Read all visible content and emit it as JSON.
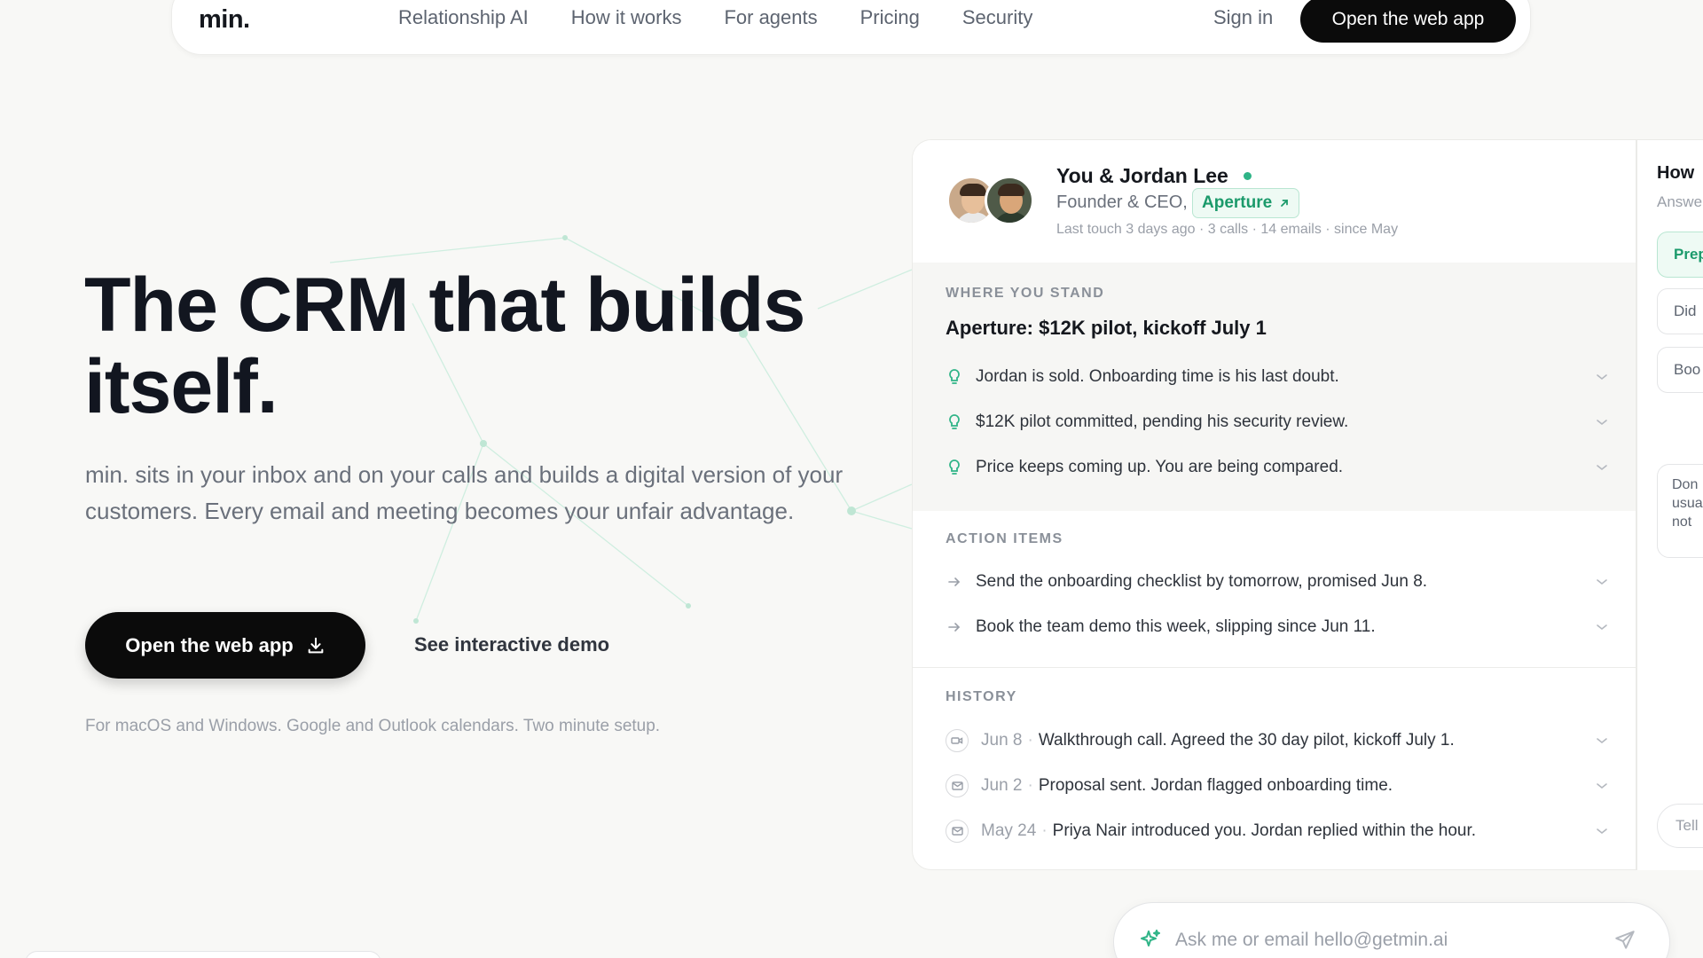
{
  "nav": {
    "logo": "min.",
    "links": [
      "Relationship AI",
      "How it works",
      "For agents",
      "Pricing",
      "Security"
    ],
    "signin": "Sign in",
    "cta": "Open the web app"
  },
  "hero": {
    "title": "The CRM that builds itself.",
    "subtitle": "min. sits in your inbox and on your calls and builds a digital version of your customers. Every email and meeting becomes your unfair advantage.",
    "cta": "Open the web app",
    "demo": "See interactive demo",
    "footnote": "For macOS and Windows. Google and Outlook calendars. Two minute setup."
  },
  "card": {
    "name": "You & Jordan Lee",
    "role": "Founder & CEO,",
    "company": "Aperture",
    "meta": "Last touch 3 days ago · 3 calls · 14 emails · since May",
    "stand": {
      "label": "WHERE YOU STAND",
      "title": "Aperture: $12K pilot, kickoff July 1",
      "items": [
        "Jordan is sold. Onboarding time is his last doubt.",
        "$12K pilot committed, pending his security review.",
        "Price keeps coming up. You are being compared."
      ]
    },
    "actions": {
      "label": "ACTION ITEMS",
      "items": [
        "Send the onboarding checklist by tomorrow, promised Jun 8.",
        "Book the team demo this week, slipping since Jun 11."
      ]
    },
    "history": {
      "label": "HISTORY",
      "items": [
        {
          "icon": "video-icon",
          "date": "Jun 8",
          "text": "Walkthrough call. Agreed the 30 day pilot, kickoff July 1."
        },
        {
          "icon": "mail-icon",
          "date": "Jun 2",
          "text": "Proposal sent. Jordan flagged onboarding time."
        },
        {
          "icon": "mail-icon",
          "date": "May 24",
          "text": "Priya Nair introduced you. Jordan replied within the hour."
        }
      ]
    }
  },
  "side_panel": {
    "title": "How",
    "subtitle": "Answe",
    "buttons": [
      "Prep",
      "Did",
      "Boo"
    ],
    "note_lines": [
      "Don",
      "usua",
      "not"
    ],
    "input_placeholder": "Tell"
  },
  "ask": {
    "placeholder": "Ask me or email hello@getmin.ai"
  },
  "colors": {
    "accent": "#2fb487",
    "dark": "#0b0b0b",
    "background": "#f8f8f6"
  }
}
